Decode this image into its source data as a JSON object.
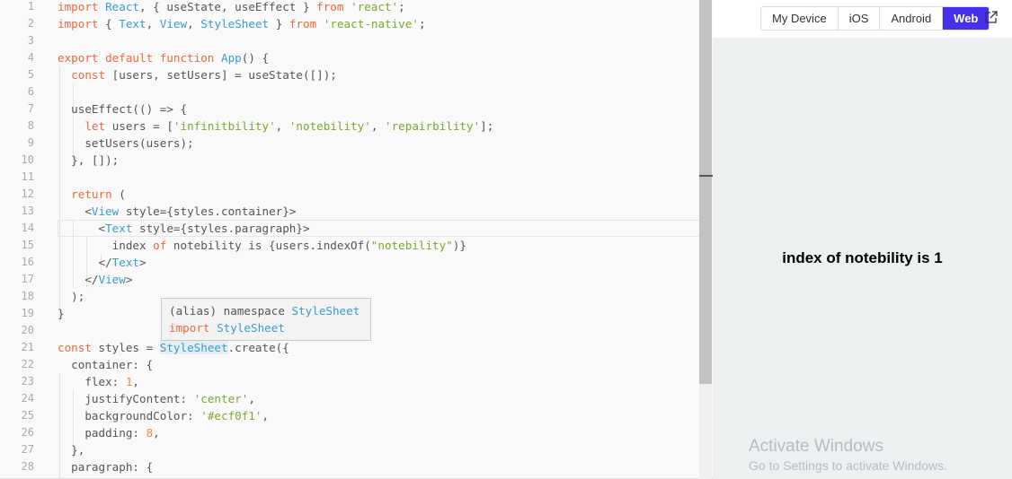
{
  "editor": {
    "current_line": 14,
    "lines": [
      [
        [
          "kw",
          "import "
        ],
        [
          "id",
          "React"
        ],
        [
          "p",
          ", { useState, useEffect } "
        ],
        [
          "kw",
          "from "
        ],
        [
          "str",
          "'react'"
        ],
        [
          "p",
          ";"
        ]
      ],
      [
        [
          "kw",
          "import "
        ],
        [
          "p",
          "{ "
        ],
        [
          "id",
          "Text"
        ],
        [
          "p",
          ", "
        ],
        [
          "id",
          "View"
        ],
        [
          "p",
          ", "
        ],
        [
          "id",
          "StyleSheet"
        ],
        [
          "p",
          " } "
        ],
        [
          "kw",
          "from "
        ],
        [
          "str",
          "'react-native'"
        ],
        [
          "p",
          ";"
        ]
      ],
      [],
      [
        [
          "kw",
          "export default function "
        ],
        [
          "id",
          "App"
        ],
        [
          "p",
          "() {"
        ]
      ],
      [
        [
          "p",
          "  "
        ],
        [
          "kw",
          "const "
        ],
        [
          "p",
          "[users, setUsers] = useState([]);"
        ]
      ],
      [],
      [
        [
          "p",
          "  useEffect(() => {"
        ]
      ],
      [
        [
          "p",
          "    "
        ],
        [
          "kw",
          "let "
        ],
        [
          "p",
          "users = ["
        ],
        [
          "str",
          "'infinitbility'"
        ],
        [
          "p",
          ", "
        ],
        [
          "str",
          "'notebility'"
        ],
        [
          "p",
          ", "
        ],
        [
          "str",
          "'repairbility'"
        ],
        [
          "p",
          "];"
        ]
      ],
      [
        [
          "p",
          "    setUsers(users);"
        ]
      ],
      [
        [
          "p",
          "  }, []);"
        ]
      ],
      [],
      [
        [
          "p",
          "  "
        ],
        [
          "kw",
          "return "
        ],
        [
          "p",
          "("
        ]
      ],
      [
        [
          "p",
          "    <"
        ],
        [
          "id",
          "View"
        ],
        [
          "p",
          " style={styles.container}>"
        ]
      ],
      [
        [
          "p",
          "      <"
        ],
        [
          "id",
          "Text"
        ],
        [
          "p",
          " style={styles.paragraph}>"
        ]
      ],
      [
        [
          "p",
          "        index "
        ],
        [
          "kw",
          "of "
        ],
        [
          "p",
          "notebility is {users.indexOf("
        ],
        [
          "str",
          "\"notebility\""
        ],
        [
          "p",
          ")}"
        ]
      ],
      [
        [
          "p",
          "      </"
        ],
        [
          "id",
          "Text"
        ],
        [
          "p",
          ">"
        ]
      ],
      [
        [
          "p",
          "    </"
        ],
        [
          "id",
          "View"
        ],
        [
          "p",
          ">"
        ]
      ],
      [
        [
          "p",
          "  );"
        ]
      ],
      [
        [
          "p",
          "}"
        ]
      ],
      [],
      [
        [
          "kw",
          "const "
        ],
        [
          "p",
          "styles = "
        ],
        [
          "idh",
          "StyleSheet"
        ],
        [
          "p",
          ".create({"
        ]
      ],
      [
        [
          "p",
          "  container: {"
        ]
      ],
      [
        [
          "p",
          "    flex: "
        ],
        [
          "num",
          "1"
        ],
        [
          "p",
          ","
        ]
      ],
      [
        [
          "p",
          "    justifyContent: "
        ],
        [
          "str",
          "'center'"
        ],
        [
          "p",
          ","
        ]
      ],
      [
        [
          "p",
          "    backgroundColor: "
        ],
        [
          "str",
          "'#ecf0f1'"
        ],
        [
          "p",
          ","
        ]
      ],
      [
        [
          "p",
          "    padding: "
        ],
        [
          "num",
          "8"
        ],
        [
          "p",
          ","
        ]
      ],
      [
        [
          "p",
          "  },"
        ]
      ],
      [
        [
          "p",
          "  paragraph: {"
        ]
      ]
    ]
  },
  "tooltip": {
    "line1_prefix": "(alias) namespace ",
    "line1_name": "StyleSheet",
    "line2_kw": "import ",
    "line2_name": "StyleSheet"
  },
  "preview": {
    "tabs": [
      "My Device",
      "iOS",
      "Android",
      "Web"
    ],
    "active_tab": "Web",
    "popout_icon": "external-link-icon",
    "output_text": "index of notebility is 1",
    "background": "#ecf0f1",
    "accent": "#4630eb"
  },
  "watermark": {
    "title": "Activate Windows",
    "subtitle": "Go to Settings to activate Windows."
  }
}
